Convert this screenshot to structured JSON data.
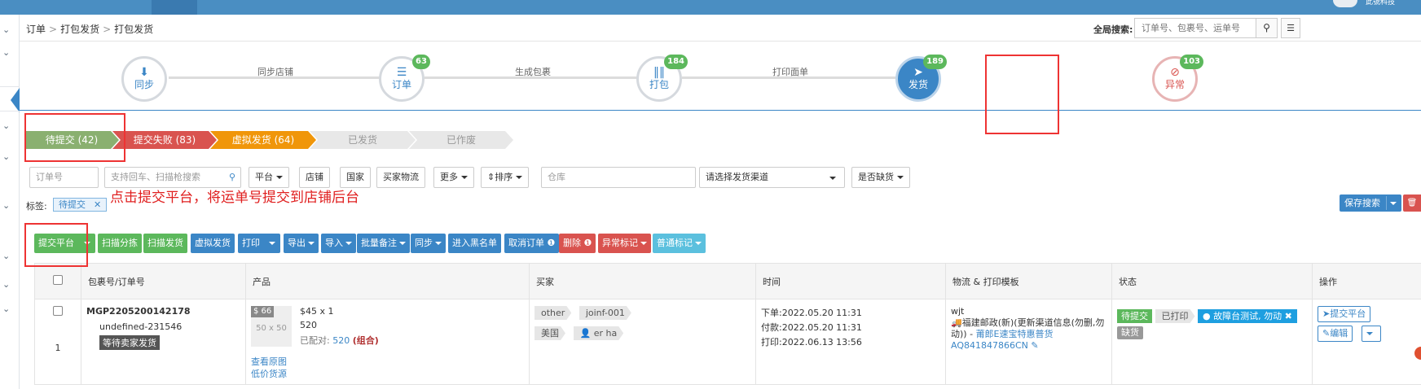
{
  "topbar": {
    "user_name": "此號科技"
  },
  "breadcrumb": [
    "订单",
    "打包发货",
    "打包发货"
  ],
  "global_search": {
    "label": "全局搜索:",
    "placeholder": "订单号、包裹号、运单号"
  },
  "steps": {
    "nodes": [
      {
        "label": "同步",
        "icon": "download-icon",
        "badge": ""
      },
      {
        "label": "订单",
        "icon": "list-icon",
        "badge": "63"
      },
      {
        "label": "打包",
        "icon": "barcode-icon",
        "badge": "184"
      },
      {
        "label": "发货",
        "icon": "paper-plane-icon",
        "badge": "189"
      },
      {
        "label": "异常",
        "icon": "eye-slash-icon",
        "badge": "103"
      }
    ],
    "connectors": [
      "同步店铺",
      "生成包裹",
      "打印面单"
    ]
  },
  "status_tabs": [
    {
      "label": "待提交 (42)",
      "color": "#8ab070"
    },
    {
      "label": "提交失败 (83)",
      "color": "#d9534f"
    },
    {
      "label": "虚拟发货 (64)",
      "color": "#f0960a"
    },
    {
      "label": "已发货",
      "color": "#e8e8e8"
    },
    {
      "label": "已作废",
      "color": "#e8e8e8"
    }
  ],
  "filters": {
    "order_no_placeholder": "订单号",
    "scan_placeholder": "支持回车、扫描枪搜索",
    "platform": "平台",
    "store": "店铺",
    "country": "国家",
    "buyer_logistics": "买家物流",
    "more": "更多",
    "sort": "排序",
    "warehouse_placeholder": "仓库",
    "channel_placeholder": "请选择发货渠道",
    "stockout": "是否缺货"
  },
  "tags": {
    "label": "标签:",
    "active": "待提交"
  },
  "save_search": "保存搜索",
  "annotation": "点击提交平台，将运单号提交到店铺后台",
  "actions": [
    {
      "label": "提交平台",
      "color": "g",
      "caret": true
    },
    {
      "label": "扫描分拣",
      "color": "g",
      "caret": false
    },
    {
      "label": "扫描发货",
      "color": "g",
      "caret": false
    },
    {
      "label": "虚拟发货",
      "color": "b",
      "caret": false
    },
    {
      "label": "打印",
      "color": "b",
      "caret": true
    },
    {
      "label": "导出",
      "color": "b",
      "caret": true
    },
    {
      "label": "导入",
      "color": "b",
      "caret": true
    },
    {
      "label": "批量备注",
      "color": "b",
      "caret": true
    },
    {
      "label": "同步",
      "color": "b",
      "caret": true
    },
    {
      "label": "进入黑名单",
      "color": "b",
      "caret": false
    },
    {
      "label": "取消订单 ❶",
      "color": "b",
      "caret": false
    },
    {
      "label": "删除 ❶",
      "color": "r",
      "caret": false
    },
    {
      "label": "异常标记",
      "color": "r",
      "caret": true
    },
    {
      "label": "普通标记",
      "color": "c",
      "caret": true
    }
  ],
  "table": {
    "headers": [
      "",
      "包裹号/订单号",
      "产品",
      "买家",
      "时间",
      "物流 & 打印模板",
      "状态",
      "操作"
    ],
    "row": {
      "index": "1",
      "package_no": "MGP2205200142178",
      "order_no": "undefined-231546",
      "order_status": "等待卖家发货",
      "price_tag": "$ 66",
      "thumb": "50 x 50",
      "qty": "$45 x 1",
      "sku": "520",
      "matched_label": "已配对:",
      "matched_value": "520",
      "matched_combo": "(组合)",
      "view_image": "查看原图",
      "low_price": "低价货源",
      "buyer_tags": [
        "other",
        "joinf-001",
        "美国",
        "er ha"
      ],
      "time_order": "下单:2022.05.20 11:31",
      "time_pay": "付款:2022.05.20 11:31",
      "time_print": "打印:2022.06.13 13:56",
      "logistics_name": "wjt",
      "logistics_channel": "🚚福建邮政(新)(更新渠道信息(勿删,勿动)) -",
      "logistics_link": "莆郎E速宝特惠普货",
      "tracking_no": "AQ841847866CN",
      "status_pending": "待提交",
      "status_printed": "已打印",
      "fault_tag": "故障台测试, 勿动",
      "stockout_tag": "缺货",
      "op_submit": "提交平台",
      "op_edit": "编辑"
    }
  }
}
